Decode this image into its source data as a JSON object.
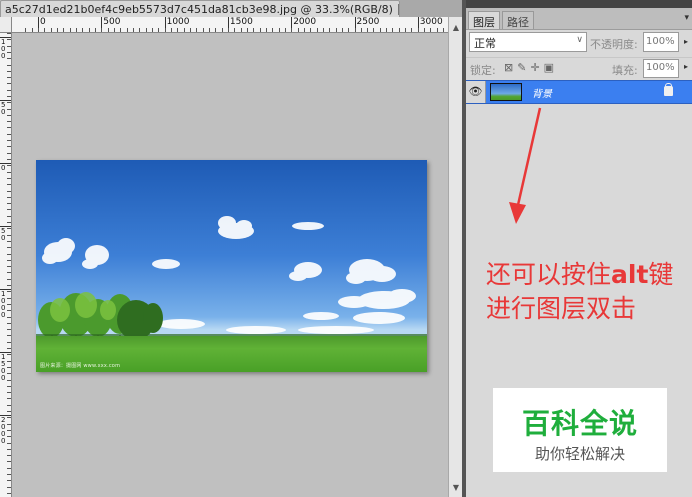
{
  "document": {
    "tab_title": "a5c27d1ed21b0ef4c9eb5573d7c451da81cb3e98.jpg @ 33.3%(RGB/8)",
    "close_glyph": "✕"
  },
  "ruler": {
    "horizontal_labels": [
      "0",
      "500",
      "1000",
      "1500",
      "2000",
      "2500",
      "3000"
    ],
    "vertical_labels": [
      "1\n0\n0",
      "5\n0",
      "0",
      "5\n0",
      "1\n0\n0\n0",
      "1\n5\n0\n0",
      "2\n0\n0\n0"
    ]
  },
  "photo": {
    "watermark": "图片来源：摄图网 www.xxx.com"
  },
  "layers_panel": {
    "tabs": [
      "图层",
      "路径"
    ],
    "menu_glyph": "▾",
    "blend_mode": "正常",
    "opacity_label": "不透明度:",
    "opacity_value": "100%",
    "lock_label": "锁定:",
    "fill_label": "填充:",
    "fill_value": "100%",
    "layer_name": "背景"
  },
  "annotation": {
    "line1_prefix": "还可以按住",
    "line1_key": "alt",
    "line1_suffix": "键",
    "line2": "进行图层双击"
  },
  "logo": {
    "title": "百科全说",
    "subtitle": "助你轻松解决"
  },
  "colors": {
    "accent": "#3b7ff0",
    "annotation": "#e83838",
    "logo_green": "#1fae3c"
  }
}
